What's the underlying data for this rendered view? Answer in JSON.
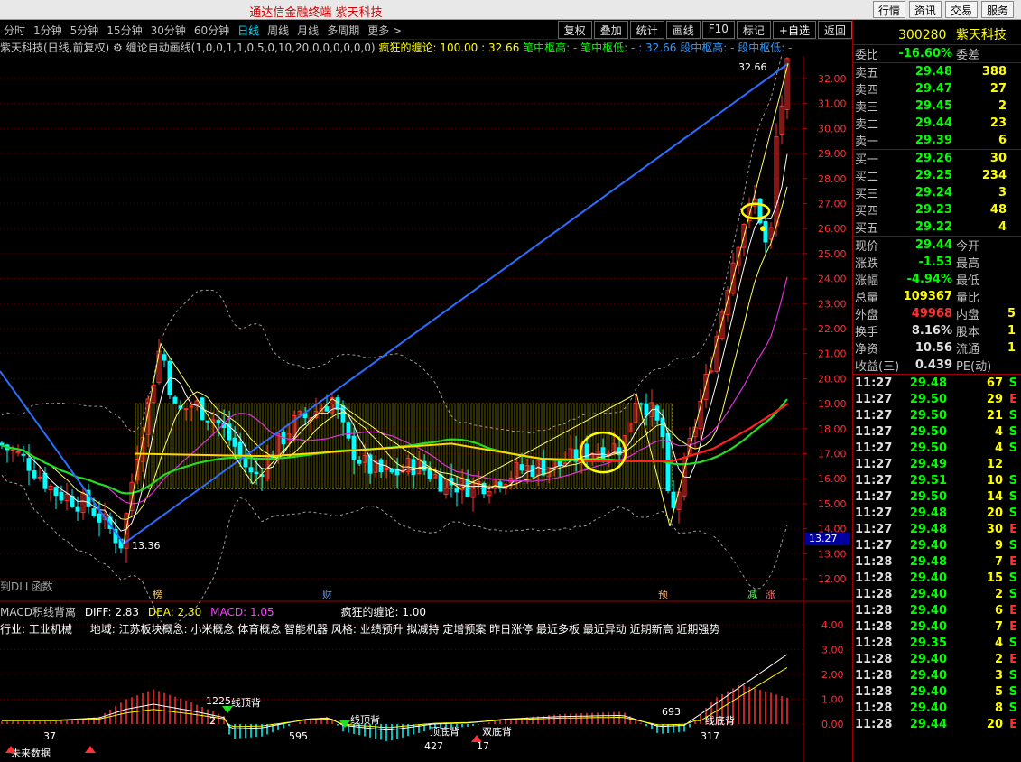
{
  "window": {
    "title": "通达信金融终端 紫天科技",
    "top_buttons": [
      "行情",
      "资讯",
      "交易",
      "服务"
    ]
  },
  "toolbar": {
    "periods": [
      "分时",
      "1分钟",
      "5分钟",
      "15分钟",
      "30分钟",
      "60分钟",
      "日线",
      "周线",
      "月线",
      "多周期",
      "更多 >"
    ],
    "active_period": "日线",
    "right_buttons": [
      "复权",
      "叠加",
      "统计",
      "画线",
      "F10",
      "标记",
      "+自选",
      "返回"
    ]
  },
  "indicator_line": {
    "stock": "紫天科技(日线,前复权)",
    "formula": "缠论自动画线(1,0,0,1,1,0,5,0,10,20,0,0,0,0,0,0)",
    "value": "疯狂的缠论: 100.00 : 32.66",
    "pivots_a": "笔中枢高: - 笔中枢低: -",
    "pivots_b": ": 32.66  段中枢高: - 段中枢低: -"
  },
  "main_chart": {
    "y_ticks": [
      "32.00",
      "31.00",
      "30.00",
      "29.00",
      "28.00",
      "27.00",
      "26.00",
      "25.00",
      "24.00",
      "23.00",
      "22.00",
      "21.00",
      "20.00",
      "19.00",
      "18.00",
      "17.00",
      "16.00",
      "15.00",
      "14.00",
      "13.00",
      "12.00"
    ],
    "current_price_tag": "13.27",
    "high_label": "32.66",
    "low_label": "13.36",
    "left_note": "到DLL函数",
    "markers": [
      "榜",
      "财",
      "预",
      "减",
      "涨"
    ]
  },
  "macd_panel": {
    "title": "MACD积线背离",
    "diff": "DIFF: 2.83",
    "dea": "DEA: 2.30",
    "macd": "MACD: 1.05",
    "crazy": "疯狂的缠论: 1.00",
    "industry": "行业: 工业机械",
    "region_concept": "地域: 江苏板块概念: 小米概念 体育概念 智能机器 风格: 业绩预升 拟减持 定增预案 昨日涨停 最近多板 最近异动 近期新高 近期强势",
    "y_ticks": [
      "4.00",
      "3.00",
      "2.00",
      "1.00",
      "0.00"
    ],
    "labels": [
      "1225",
      "线顶背",
      "2",
      "595",
      "线顶背",
      "427",
      "顶底背",
      "17",
      "双底背",
      "693",
      "317",
      "线底背",
      "37",
      "未来数据"
    ]
  },
  "quote": {
    "code": "300280",
    "name": "紫天科技",
    "weibi_label": "委比",
    "weibi": "-16.60%",
    "weicha_label": "委差",
    "sells": [
      {
        "label": "卖五",
        "price": "29.48",
        "vol": "388"
      },
      {
        "label": "卖四",
        "price": "29.47",
        "vol": "27"
      },
      {
        "label": "卖三",
        "price": "29.45",
        "vol": "2"
      },
      {
        "label": "卖二",
        "price": "29.44",
        "vol": "23"
      },
      {
        "label": "卖一",
        "price": "29.39",
        "vol": "6"
      }
    ],
    "buys": [
      {
        "label": "买一",
        "price": "29.26",
        "vol": "30"
      },
      {
        "label": "买二",
        "price": "29.25",
        "vol": "234"
      },
      {
        "label": "买三",
        "price": "29.24",
        "vol": "3"
      },
      {
        "label": "买四",
        "price": "29.23",
        "vol": "48"
      },
      {
        "label": "买五",
        "price": "29.22",
        "vol": "4"
      }
    ],
    "stats": [
      {
        "l1": "现价",
        "v1": "29.44",
        "c1": "green",
        "l2": "今开",
        "v2": ""
      },
      {
        "l1": "涨跌",
        "v1": "-1.53",
        "c1": "green",
        "l2": "最高",
        "v2": ""
      },
      {
        "l1": "涨幅",
        "v1": "-4.94%",
        "c1": "green",
        "l2": "最低",
        "v2": ""
      },
      {
        "l1": "总量",
        "v1": "109367",
        "c1": "yellow",
        "l2": "量比",
        "v2": ""
      },
      {
        "l1": "外盘",
        "v1": "49968",
        "c1": "red",
        "l2": "内盘",
        "v2": "5"
      },
      {
        "l1": "换手",
        "v1": "8.16%",
        "c1": "white",
        "l2": "股本",
        "v2": "1"
      },
      {
        "l1": "净资",
        "v1": "10.56",
        "c1": "white",
        "l2": "流通",
        "v2": "1"
      },
      {
        "l1": "收益(三)",
        "v1": "0.439",
        "c1": "white",
        "l2": "PE(动)",
        "v2": ""
      }
    ],
    "ticks": [
      {
        "t": "11:27",
        "p": "29.48",
        "c": "green",
        "v": "67",
        "f": "S"
      },
      {
        "t": "11:27",
        "p": "29.50",
        "c": "green",
        "v": "29",
        "f": "E"
      },
      {
        "t": "11:27",
        "p": "29.50",
        "c": "green",
        "v": "21",
        "f": "S"
      },
      {
        "t": "11:27",
        "p": "29.50",
        "c": "green",
        "v": "4",
        "f": "S"
      },
      {
        "t": "11:27",
        "p": "29.50",
        "c": "green",
        "v": "4",
        "f": "S"
      },
      {
        "t": "11:27",
        "p": "29.49",
        "c": "green",
        "v": "12",
        "f": ""
      },
      {
        "t": "11:27",
        "p": "29.51",
        "c": "green",
        "v": "10",
        "f": "S"
      },
      {
        "t": "11:27",
        "p": "29.50",
        "c": "green",
        "v": "14",
        "f": "S"
      },
      {
        "t": "11:27",
        "p": "29.48",
        "c": "green",
        "v": "20",
        "f": "S"
      },
      {
        "t": "11:27",
        "p": "29.48",
        "c": "green",
        "v": "30",
        "f": "E"
      },
      {
        "t": "11:27",
        "p": "29.40",
        "c": "green",
        "v": "9",
        "f": "S"
      },
      {
        "t": "11:28",
        "p": "29.48",
        "c": "green",
        "v": "7",
        "f": "E"
      },
      {
        "t": "11:28",
        "p": "29.40",
        "c": "green",
        "v": "15",
        "f": "S"
      },
      {
        "t": "11:28",
        "p": "29.40",
        "c": "green",
        "v": "2",
        "f": "S"
      },
      {
        "t": "11:28",
        "p": "29.40",
        "c": "green",
        "v": "6",
        "f": "E"
      },
      {
        "t": "11:28",
        "p": "29.40",
        "c": "green",
        "v": "7",
        "f": "E"
      },
      {
        "t": "11:28",
        "p": "29.35",
        "c": "green",
        "v": "4",
        "f": "S"
      },
      {
        "t": "11:28",
        "p": "29.40",
        "c": "green",
        "v": "2",
        "f": "E"
      },
      {
        "t": "11:28",
        "p": "29.40",
        "c": "green",
        "v": "3",
        "f": "S"
      },
      {
        "t": "11:28",
        "p": "29.40",
        "c": "green",
        "v": "5",
        "f": "S"
      },
      {
        "t": "11:28",
        "p": "29.40",
        "c": "green",
        "v": "8",
        "f": "S"
      },
      {
        "t": "11:28",
        "p": "29.44",
        "c": "green",
        "v": "20",
        "f": "E"
      }
    ]
  },
  "colors": {
    "up": "#ff3030",
    "down": "#00ffff",
    "blue_line": "#2a6fff",
    "green_ma": "#22dd22",
    "yellow_ma": "#ffd700",
    "magenta_ma": "#dd33dd",
    "red_ma": "#ff2020"
  }
}
